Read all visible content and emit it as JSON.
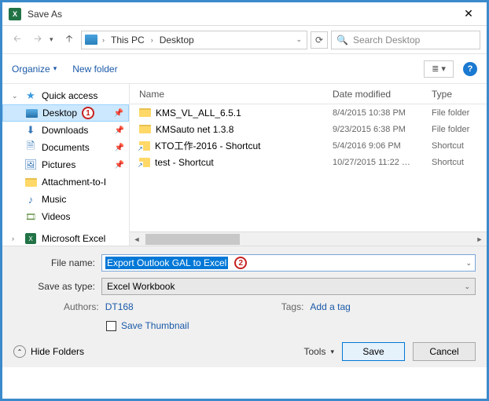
{
  "title": "Save As",
  "breadcrumb": {
    "root": "This PC",
    "leaf": "Desktop"
  },
  "search_placeholder": "Search Desktop",
  "toolbar": {
    "organize": "Organize",
    "newfolder": "New folder"
  },
  "tree": {
    "quick": "Quick access",
    "desktop": "Desktop",
    "downloads": "Downloads",
    "documents": "Documents",
    "pictures": "Pictures",
    "attach": "Attachment-to-I",
    "music": "Music",
    "videos": "Videos",
    "msexcel": "Microsoft Excel"
  },
  "columns": {
    "name": "Name",
    "date": "Date modified",
    "type": "Type"
  },
  "files": [
    {
      "name": "KMS_VL_ALL_6.5.1",
      "date": "8/4/2015 10:38 PM",
      "type": "File folder",
      "icon": "folder"
    },
    {
      "name": "KMSauto net 1.3.8",
      "date": "9/23/2015 6:38 PM",
      "type": "File folder",
      "icon": "folder"
    },
    {
      "name": "KTO工作-2016 - Shortcut",
      "date": "5/4/2016 9:06 PM",
      "type": "Shortcut",
      "icon": "shortcut"
    },
    {
      "name": "test - Shortcut",
      "date": "10/27/2015 11:22 …",
      "type": "Shortcut",
      "icon": "shortcut"
    }
  ],
  "form": {
    "filename_label": "File name:",
    "filename_value": "Export Outlook GAL to Excel",
    "type_label": "Save as type:",
    "type_value": "Excel Workbook",
    "authors_label": "Authors:",
    "authors_value": "DT168",
    "tags_label": "Tags:",
    "tags_value": "Add a tag",
    "thumb": "Save Thumbnail"
  },
  "buttons": {
    "hide": "Hide Folders",
    "tools": "Tools",
    "save": "Save",
    "cancel": "Cancel"
  },
  "annotations": {
    "one": "1",
    "two": "2"
  }
}
